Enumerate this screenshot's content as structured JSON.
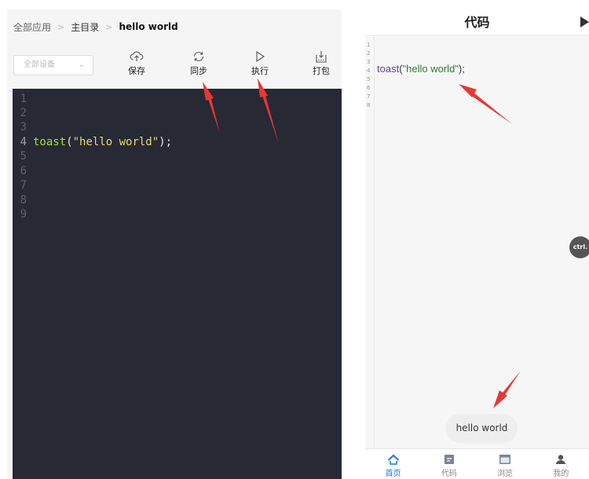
{
  "left": {
    "breadcrumb": {
      "home": "全部应用",
      "dir": "主目录",
      "current": "hello world"
    },
    "device_select": {
      "value": "全部设备"
    },
    "toolbar": {
      "save_label": "保存",
      "sync_label": "同步",
      "run_label": "执行",
      "pack_label": "打包"
    },
    "editor": {
      "line_numbers": [
        "1",
        "2",
        "3",
        "4",
        "5",
        "6",
        "7",
        "8",
        "9"
      ],
      "code_line4": {
        "fn": "toast",
        "open": "(",
        "str": "\"hello world\"",
        "close": ");"
      }
    }
  },
  "right": {
    "header": {
      "title": "代码"
    },
    "editor": {
      "line_numbers": [
        "1",
        "2",
        "3",
        "4",
        "5",
        "6",
        "7",
        "8"
      ],
      "code_line4": {
        "fn": "toast",
        "open": "(",
        "str": "\"hello world\"",
        "close": ");"
      }
    },
    "ctrl_button": "ctrl.",
    "toast": "hello world",
    "tabs": [
      {
        "label": "首页",
        "icon": "home-icon"
      },
      {
        "label": "代码",
        "icon": "code-icon"
      },
      {
        "label": "浏览",
        "icon": "browser-icon"
      },
      {
        "label": "我的",
        "icon": "user-icon"
      }
    ]
  },
  "colors": {
    "editor_bg": "#272935",
    "accent_blue": "#1677ff",
    "arrow_red": "#e53935"
  }
}
